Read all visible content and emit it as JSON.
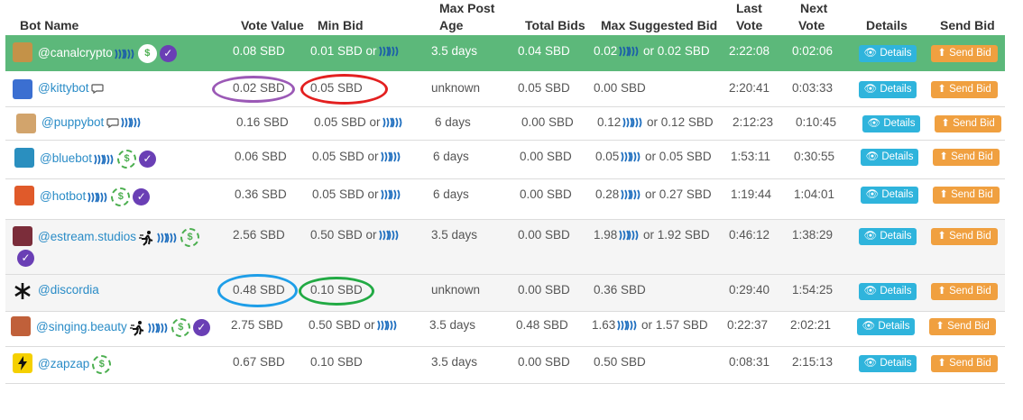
{
  "headers": {
    "bot_name": "Bot Name",
    "vote_value": "Vote Value",
    "min_bid": "Min Bid",
    "max_post_age_1": "Max Post",
    "max_post_age_2": "Age",
    "total_bids": "Total Bids",
    "max_suggested_bid": "Max Suggested Bid",
    "last_vote_1": "Last",
    "last_vote_2": "Vote",
    "next_vote_1": "Next",
    "next_vote_2": "Vote",
    "details": "Details",
    "send_bid": "Send Bid"
  },
  "buttons": {
    "details": "Details",
    "send_bid": "Send Bid"
  },
  "colors": {
    "highlight_row": "#5cb87a",
    "details_btn": "#2fb4dc",
    "send_bid_btn": "#f0a040",
    "verified": "#6a3fb5",
    "purple_mark": "#9b59b6",
    "red_mark": "#e32020",
    "blue_mark": "#1e9ee8",
    "green_mark": "#22aa44"
  },
  "rows": [
    {
      "name": "@canalcrypto",
      "vote_value": "0.08 SBD",
      "min_bid": "0.01 SBD or",
      "max_post_age": "3.5 days",
      "total_bids": "0.04 SBD",
      "max_suggested_a": "0.02",
      "max_suggested_b": "or 0.02 SBD",
      "last_vote": "2:22:08",
      "next_vote": "0:02:06"
    },
    {
      "name": "@kittybot",
      "vote_value": "0.02 SBD",
      "min_bid": "0.05 SBD",
      "max_post_age": "unknown",
      "total_bids": "0.05 SBD",
      "max_suggested_a": "0.00 SBD",
      "max_suggested_b": "",
      "last_vote": "2:20:41",
      "next_vote": "0:03:33"
    },
    {
      "name": "@puppybot",
      "vote_value": "0.16 SBD",
      "min_bid": "0.05 SBD or",
      "max_post_age": "6 days",
      "total_bids": "0.00 SBD",
      "max_suggested_a": "0.12",
      "max_suggested_b": "or 0.12 SBD",
      "last_vote": "2:12:23",
      "next_vote": "0:10:45"
    },
    {
      "name": "@bluebot",
      "vote_value": "0.06 SBD",
      "min_bid": "0.05 SBD or",
      "max_post_age": "6 days",
      "total_bids": "0.00 SBD",
      "max_suggested_a": "0.05",
      "max_suggested_b": "or 0.05 SBD",
      "last_vote": "1:53:11",
      "next_vote": "0:30:55"
    },
    {
      "name": "@hotbot",
      "vote_value": "0.36 SBD",
      "min_bid": "0.05 SBD or",
      "max_post_age": "6 days",
      "total_bids": "0.00 SBD",
      "max_suggested_a": "0.28",
      "max_suggested_b": "or 0.27 SBD",
      "last_vote": "1:19:44",
      "next_vote": "1:04:01"
    },
    {
      "name": "@estream.studios",
      "vote_value": "2.56 SBD",
      "min_bid": "0.50 SBD or",
      "max_post_age": "3.5 days",
      "total_bids": "0.00 SBD",
      "max_suggested_a": "1.98",
      "max_suggested_b": "or 1.92 SBD",
      "last_vote": "0:46:12",
      "next_vote": "1:38:29"
    },
    {
      "name": "@discordia",
      "vote_value": "0.48 SBD",
      "min_bid": "0.10 SBD",
      "max_post_age": "unknown",
      "total_bids": "0.00 SBD",
      "max_suggested_a": "0.36 SBD",
      "max_suggested_b": "",
      "last_vote": "0:29:40",
      "next_vote": "1:54:25"
    },
    {
      "name": "@singing.beauty",
      "vote_value": "2.75 SBD",
      "min_bid": "0.50 SBD or",
      "max_post_age": "3.5 days",
      "total_bids": "0.48 SBD",
      "max_suggested_a": "1.63",
      "max_suggested_b": "or 1.57 SBD",
      "last_vote": "0:22:37",
      "next_vote": "2:02:21"
    },
    {
      "name": "@zapzap",
      "vote_value": "0.67 SBD",
      "min_bid": "0.10 SBD",
      "max_post_age": "3.5 days",
      "total_bids": "0.00 SBD",
      "max_suggested_a": "0.50 SBD",
      "max_suggested_b": "",
      "last_vote": "0:08:31",
      "next_vote": "2:15:13"
    }
  ]
}
